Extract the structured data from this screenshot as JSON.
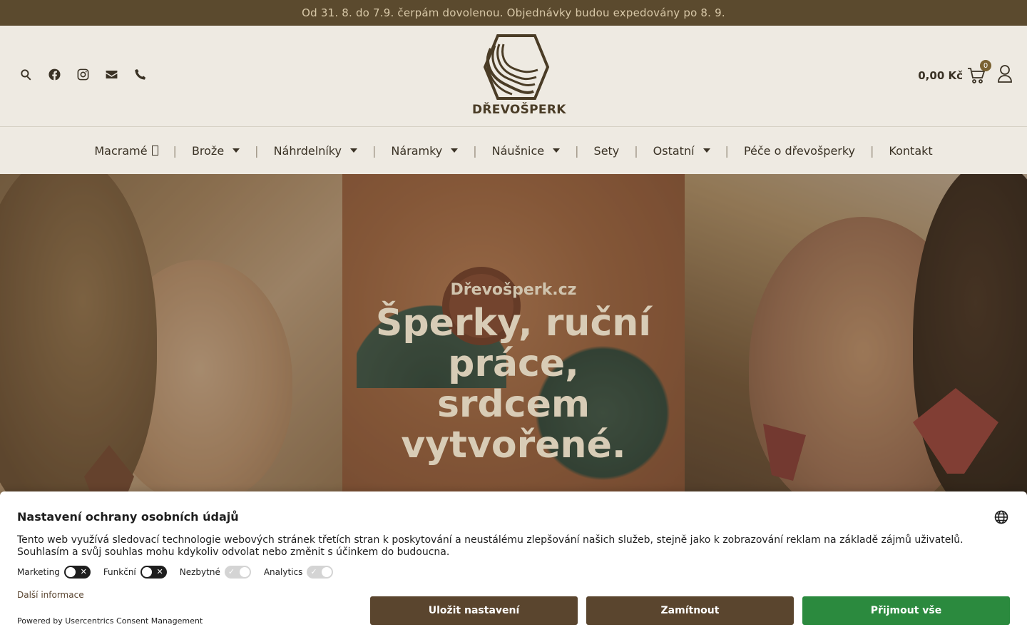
{
  "topbar": {
    "text": "Od 31. 8. do 7.9. čerpám dovolenou. Objednávky budou expedovány po 8. 9."
  },
  "header": {
    "icons": [
      "search-icon",
      "facebook-icon",
      "instagram-icon",
      "envelope-icon",
      "phone-icon"
    ],
    "logo_text": "DŘEVOŠPERK",
    "cart_price": "0,00 Kč",
    "cart_count": "0"
  },
  "nav": {
    "items": [
      {
        "label": "Macramé"
      },
      {
        "label": "Brože"
      },
      {
        "label": "Náhrdelníky"
      },
      {
        "label": "Náramky"
      },
      {
        "label": "Náušnice"
      },
      {
        "label": "Sety"
      },
      {
        "label": "Ostatní"
      },
      {
        "label": "Péče o dřevošperky"
      },
      {
        "label": "Kontakt"
      }
    ],
    "separator": "|"
  },
  "hero": {
    "subtitle": "Dřevošperk.cz",
    "title_lines": [
      "Šperky, ruční",
      "práce,",
      "srdcem",
      "vytvořené."
    ]
  },
  "consent": {
    "title": "Nastavení ochrany osobních údajů",
    "text": "Tento web využívá sledovací technologie webových stránek třetích stran k poskytování a neustálému zlepšování našich služeb, stejně jako k zobrazování reklam na základě zájmů uživatelů. Souhlasím a svůj souhlas mohu kdykoliv odvolat nebo změnit s účinkem do budoucna.",
    "toggles": [
      {
        "label": "Marketing",
        "state": "off"
      },
      {
        "label": "Funkční",
        "state": "off"
      },
      {
        "label": "Nezbytné",
        "state": "disabled-on"
      },
      {
        "label": "Analytics",
        "state": "disabled-on"
      }
    ],
    "more_link": "Další informace",
    "powered_by": "Powered by Usercentrics Consent Management",
    "buttons": {
      "save": "Uložit nastavení",
      "deny": "Zamítnout",
      "accept": "Přijmout vše"
    }
  },
  "colors": {
    "topbar_bg": "#5b4a2e",
    "header_bg": "#eeeae2",
    "button_brown": "#5a452e",
    "button_green": "#2b8a3e"
  }
}
